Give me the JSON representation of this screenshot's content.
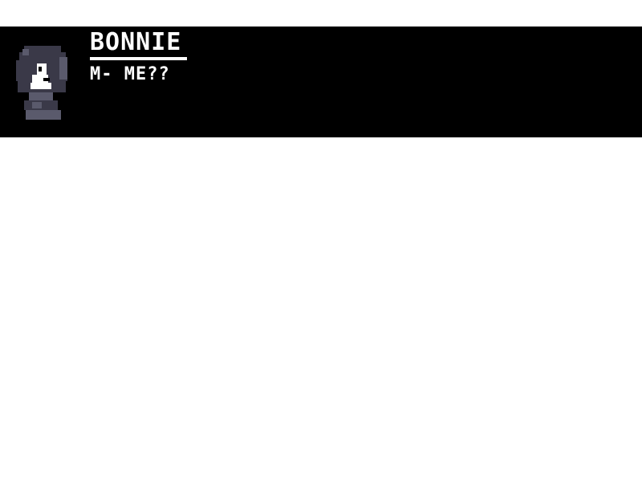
{
  "dialogue": {
    "speaker": "BONNIE",
    "text": "M- ME??",
    "portrait_icon": "bonnie-portrait-icon"
  },
  "colors": {
    "background": "#ffffff",
    "box": "#000000",
    "text": "#ffffff",
    "portrait_dark": "#3a3948",
    "portrait_mid": "#5a5a6c",
    "portrait_light": "#ffffff"
  }
}
